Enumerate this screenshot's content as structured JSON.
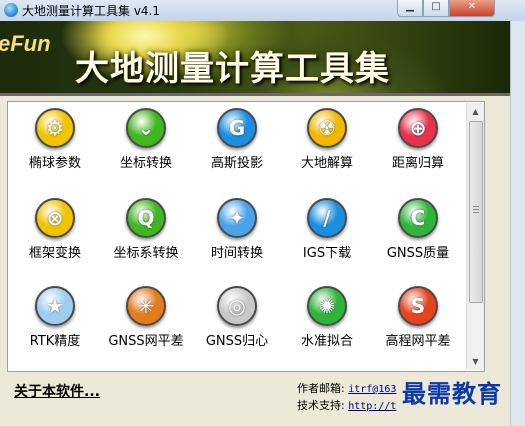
{
  "window": {
    "title": "大地测量计算工具集 v4.1"
  },
  "banner": {
    "brand_fragment": "eFun",
    "title": "大地测量计算工具集"
  },
  "tools": [
    {
      "label": "椭球参数",
      "icon": "gear-icon",
      "color": "#f2c300",
      "glyph": "⚙"
    },
    {
      "label": "坐标转换",
      "icon": "double-chevron-down-icon",
      "color": "#3fb81f",
      "glyph": "⌄"
    },
    {
      "label": "高斯投影",
      "icon": "letter-g-icon",
      "color": "#1b8ee0",
      "glyph": "G"
    },
    {
      "label": "大地解算",
      "icon": "radiation-icon",
      "color": "#f0b800",
      "glyph": "☢"
    },
    {
      "label": "距离归算",
      "icon": "target-icon",
      "color": "#e8324c",
      "glyph": "⊕"
    },
    {
      "label": "框架变换",
      "icon": "globe-icon",
      "color": "#f2c300",
      "glyph": "⊗"
    },
    {
      "label": "坐标系转换",
      "icon": "letter-q-icon",
      "color": "#3fb81f",
      "glyph": "Q"
    },
    {
      "label": "时间转换",
      "icon": "compass-icon",
      "color": "#4aa2e8",
      "glyph": "✦"
    },
    {
      "label": "IGS下载",
      "icon": "slash-icon",
      "color": "#1b8ee0",
      "glyph": "/"
    },
    {
      "label": "GNSS质量",
      "icon": "crescent-icon",
      "color": "#2fb53a",
      "glyph": "C"
    },
    {
      "label": "RTK精度",
      "icon": "star-icon",
      "color": "#9ecdf0",
      "glyph": "★"
    },
    {
      "label": "GNSS网平差",
      "icon": "network-icon",
      "color": "#e47c1c",
      "glyph": "✳"
    },
    {
      "label": "GNSS归心",
      "icon": "ring-icon",
      "color": "#c8c8c8",
      "glyph": "◎"
    },
    {
      "label": "水准拟合",
      "icon": "spinner-icon",
      "color": "#2fb53a",
      "glyph": "✺"
    },
    {
      "label": "高程网平差",
      "icon": "letter-s-icon",
      "color": "#e8441c",
      "glyph": "S"
    }
  ],
  "footer": {
    "about_label": "关于本软件...",
    "author_label": "作者邮箱:",
    "author_value": "itrf@163",
    "support_label": "技术支持:",
    "support_value": "http://t"
  },
  "watermark": "最需教育"
}
